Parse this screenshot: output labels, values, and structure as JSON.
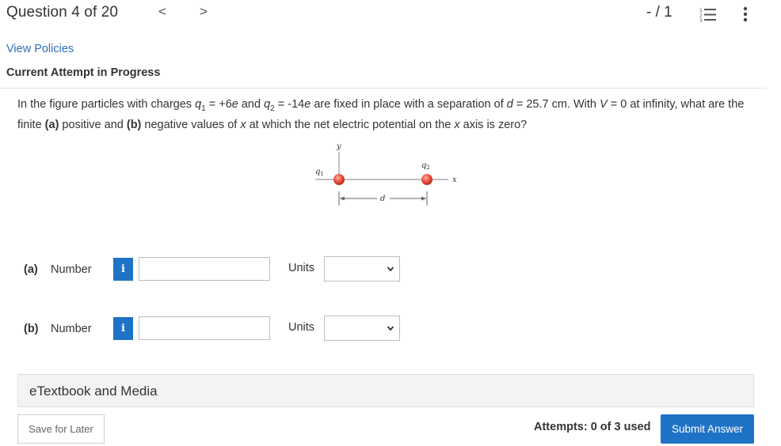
{
  "header": {
    "title": "Question 4 of 20",
    "prev_label": "<",
    "next_label": ">",
    "score": "- / 1",
    "list_icon": "numbered-list-icon",
    "more_icon": "vertical-ellipsis-icon"
  },
  "links": {
    "view_policies": "View Policies"
  },
  "status": {
    "attempt": "Current Attempt in Progress"
  },
  "question": {
    "t1": "In the figure particles with charges ",
    "q1": "q",
    "q1_sub": "1",
    "t2": " = +6",
    "e1": "e",
    "t3": " and ",
    "q2": "q",
    "q2_sub": "2",
    "t4": " = -14",
    "e2": "e",
    "t5": " are fixed in place with a separation of ",
    "d": "d",
    "t6": " = 25.7 cm. With ",
    "v": "V",
    "t7": " = 0 at infinity, what are the finite ",
    "part_a": "(a)",
    "t8": " positive and ",
    "part_b": "(b)",
    "t9": " negative values of ",
    "x": "x",
    "t10": " at which the net electric potential on the ",
    "x2": "x",
    "t11": " axis is zero?"
  },
  "figure": {
    "y_label": "y",
    "x_label": "x",
    "q1_label": "q",
    "q1_sub": "1",
    "q2_label": "q",
    "q2_sub": "2",
    "d_label": "d",
    "charge_color": "#e84a3a"
  },
  "answers": [
    {
      "part": "(a)",
      "label": "Number",
      "info": "i",
      "value": "",
      "units_label": "Units",
      "units_value": ""
    },
    {
      "part": "(b)",
      "label": "Number",
      "info": "i",
      "value": "",
      "units_label": "Units",
      "units_value": ""
    }
  ],
  "etextbook": "eTextbook and Media",
  "footer": {
    "save_label": "Save for Later",
    "attempts_used": "Attempts: 0 of 3 used",
    "submit_label": "Submit Answer"
  },
  "colors": {
    "accent": "#1f73c7",
    "link": "#2a6ebb"
  }
}
